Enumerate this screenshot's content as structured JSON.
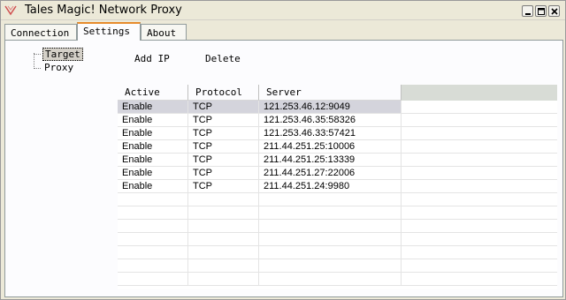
{
  "window": {
    "title": "Tales Magic! Network Proxy"
  },
  "tabs": [
    {
      "label": "Connection"
    },
    {
      "label": "Settings"
    },
    {
      "label": "About"
    }
  ],
  "tree": {
    "items": [
      {
        "label": "Target",
        "selected": true
      },
      {
        "label": "Proxy",
        "selected": false
      }
    ]
  },
  "toolbar": {
    "add_label": "Add IP",
    "delete_label": "Delete"
  },
  "grid": {
    "columns": [
      "Active",
      "Protocol",
      "Server"
    ],
    "rows": [
      {
        "active": "Enable",
        "protocol": "TCP",
        "server": "121.253.46.12:9049"
      },
      {
        "active": "Enable",
        "protocol": "TCP",
        "server": "121.253.46.35:58326"
      },
      {
        "active": "Enable",
        "protocol": "TCP",
        "server": "121.253.46.33:57421"
      },
      {
        "active": "Enable",
        "protocol": "TCP",
        "server": "211.44.251.25:10006"
      },
      {
        "active": "Enable",
        "protocol": "TCP",
        "server": "211.44.251.25:13339"
      },
      {
        "active": "Enable",
        "protocol": "TCP",
        "server": "211.44.251.27:22006"
      },
      {
        "active": "Enable",
        "protocol": "TCP",
        "server": "211.44.251.24:9980"
      }
    ],
    "selected_row": 0
  },
  "colors": {
    "tab_active_accent": "#e68b2c",
    "selection": "#d4d4dc",
    "header_filler": "#d8dcd6"
  }
}
